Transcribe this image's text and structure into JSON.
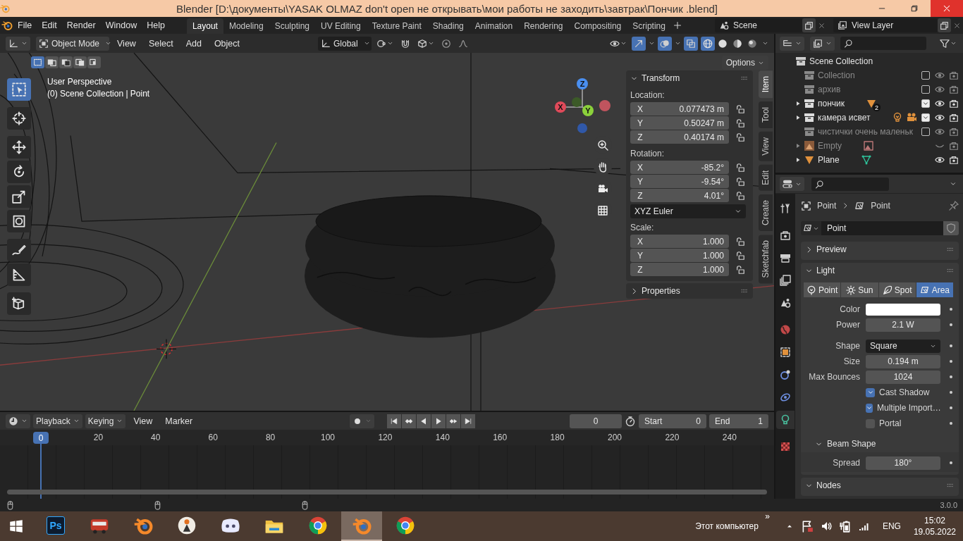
{
  "window": {
    "title": "Blender [D:\\документы\\YASAK OLMAZ don't open не открывать\\мои работы не заходить\\завтрак\\Пончик  .blend]"
  },
  "menu": [
    "File",
    "Edit",
    "Render",
    "Window",
    "Help"
  ],
  "workspaces": [
    {
      "label": "Layout",
      "selected": true
    },
    {
      "label": "Modeling",
      "selected": false
    },
    {
      "label": "Sculpting",
      "selected": false
    },
    {
      "label": "UV Editing",
      "selected": false
    },
    {
      "label": "Texture Paint",
      "selected": false
    },
    {
      "label": "Shading",
      "selected": false
    },
    {
      "label": "Animation",
      "selected": false
    },
    {
      "label": "Rendering",
      "selected": false
    },
    {
      "label": "Compositing",
      "selected": false
    },
    {
      "label": "Scripting",
      "selected": false
    }
  ],
  "scene": "Scene",
  "view_layer": "View Layer",
  "viewport": {
    "mode": "Object Mode",
    "menus": [
      "View",
      "Select",
      "Add",
      "Object"
    ],
    "orientation": "Global",
    "xray": true,
    "overlays": true,
    "gizmos": true,
    "shading": [
      {
        "kind": "wireframe",
        "selected": true
      },
      {
        "kind": "solid",
        "selected": false
      },
      {
        "kind": "material",
        "selected": false
      },
      {
        "kind": "rendered",
        "selected": false
      }
    ],
    "select_modes": [
      {
        "kind": "new",
        "selected": true
      },
      {
        "kind": "extend",
        "selected": false
      },
      {
        "kind": "subtract",
        "selected": false
      },
      {
        "kind": "invert",
        "selected": false
      },
      {
        "kind": "intersect",
        "selected": false
      }
    ],
    "options": "Options",
    "overlay_lines": [
      "User Perspective",
      "(0) Scene Collection | Point"
    ],
    "tools": [
      {
        "kind": "select",
        "selected": true
      },
      {
        "kind": "cursor",
        "selected": false
      },
      {
        "kind": "move",
        "selected": false
      },
      {
        "kind": "rotate",
        "selected": false
      },
      {
        "kind": "scale",
        "selected": false
      },
      {
        "kind": "transform",
        "selected": false
      },
      {
        "kind": "annotate",
        "selected": false
      },
      {
        "kind": "measure",
        "selected": false
      },
      {
        "kind": "add",
        "selected": false
      }
    ],
    "gizmo": [
      "X",
      "Y",
      "Z"
    ],
    "sidebar": {
      "tabs": [
        {
          "label": "Item",
          "selected": true
        },
        {
          "label": "Tool",
          "selected": false
        },
        {
          "label": "View",
          "selected": false
        },
        {
          "label": "Edit",
          "selected": false
        },
        {
          "label": "Create",
          "selected": false
        },
        {
          "label": "Sketchfab",
          "selected": false
        }
      ],
      "transform": {
        "title": "Transform",
        "expanded": true,
        "groups": [
          {
            "label": "Location:",
            "rows": [
              {
                "axis": "X",
                "value": "0.077473 m"
              },
              {
                "axis": "Y",
                "value": "0.50247 m"
              },
              {
                "axis": "Z",
                "value": "0.40174 m"
              }
            ]
          },
          {
            "label": "Rotation:",
            "rows": [
              {
                "axis": "X",
                "value": "-85.2°"
              },
              {
                "axis": "Y",
                "value": "-9.54°"
              },
              {
                "axis": "Z",
                "value": "4.01°"
              }
            ],
            "mode": "XYZ Euler"
          },
          {
            "label": "Scale:",
            "rows": [
              {
                "axis": "X",
                "value": "1.000"
              },
              {
                "axis": "Y",
                "value": "1.000"
              },
              {
                "axis": "Z",
                "value": "1.000"
              }
            ]
          }
        ]
      },
      "properties": {
        "title": "Properties",
        "expanded": false
      }
    }
  },
  "timeline": {
    "menus": [
      {
        "label": "Playback",
        "kind": "dropdown"
      },
      {
        "label": "Keying",
        "kind": "dropdown"
      },
      {
        "label": "View",
        "kind": "plain"
      },
      {
        "label": "Marker",
        "kind": "plain"
      }
    ],
    "frame": "0",
    "start": {
      "label": "Start",
      "value": "0"
    },
    "end": {
      "label": "End",
      "value": "1"
    },
    "playhead": "0",
    "ticks": [
      "20",
      "40",
      "60",
      "80",
      "100",
      "120",
      "140",
      "160",
      "180",
      "200",
      "220",
      "240"
    ]
  },
  "outliner": {
    "root": "Scene Collection",
    "items": [
      {
        "name": "Collection",
        "kind": "collection",
        "expandable": false,
        "dimmed": true,
        "checked": false,
        "visible": true
      },
      {
        "name": "архив",
        "kind": "collection",
        "expandable": false,
        "dimmed": true,
        "checked": false,
        "visible": true
      },
      {
        "name": "пончик",
        "kind": "collection",
        "expandable": true,
        "dimmed": false,
        "checked": true,
        "visible": true,
        "contents": [
          {
            "kind": "mesh",
            "count": "2"
          }
        ]
      },
      {
        "name": "камера исвет",
        "kind": "collection",
        "expandable": true,
        "dimmed": false,
        "checked": true,
        "visible": true,
        "contents": [
          {
            "kind": "light"
          },
          {
            "kind": "camera"
          }
        ]
      },
      {
        "name": "чистички очень маленьк",
        "kind": "collection",
        "expandable": false,
        "dimmed": true,
        "checked": false,
        "visible": true
      },
      {
        "name": "Empty",
        "kind": "empty",
        "expandable": true,
        "dimmed": true,
        "visible": false,
        "contents": [
          {
            "kind": "image"
          }
        ]
      },
      {
        "name": "Plane",
        "kind": "mesh",
        "expandable": true,
        "dimmed": false,
        "visible": true,
        "contents": [
          {
            "kind": "vertices"
          }
        ]
      }
    ]
  },
  "properties": {
    "tabs": [
      {
        "kind": "tool",
        "selected": false
      },
      {
        "kind": "render",
        "selected": false
      },
      {
        "kind": "output",
        "selected": false
      },
      {
        "kind": "view-layer",
        "selected": false
      },
      {
        "kind": "scene",
        "selected": false
      },
      {
        "kind": "world",
        "selected": false
      },
      {
        "kind": "object",
        "selected": false
      },
      {
        "kind": "physics",
        "selected": false
      },
      {
        "kind": "constraints",
        "selected": false
      },
      {
        "kind": "light-data",
        "selected": true
      },
      {
        "kind": "texture",
        "selected": false
      }
    ],
    "breadcrumb": [
      "Point",
      "Point"
    ],
    "datablock": "Point",
    "panels": [
      {
        "title": "Preview",
        "expanded": false
      },
      {
        "title": "Light",
        "expanded": true,
        "types": [
          {
            "kind": "point",
            "label": "Point",
            "selected": false
          },
          {
            "kind": "sun",
            "label": "Sun",
            "selected": false
          },
          {
            "kind": "spot",
            "label": "Spot",
            "selected": false
          },
          {
            "kind": "area",
            "label": "Area",
            "selected": true
          }
        ],
        "rows": [
          {
            "kind": "color",
            "label": "Color",
            "color": "#ffffff"
          },
          {
            "kind": "number",
            "label": "Power",
            "value": "2.1 W"
          },
          {
            "kind": "select",
            "label": "Shape",
            "value": "Square"
          },
          {
            "kind": "number",
            "label": "Size",
            "value": "0.194 m"
          },
          {
            "kind": "number",
            "label": "Max Bounces",
            "value": "1024"
          },
          {
            "kind": "check",
            "label": "Cast Shadow",
            "checked": true
          },
          {
            "kind": "check",
            "label": "Multiple Import…",
            "checked": true
          },
          {
            "kind": "check",
            "label": "Portal",
            "checked": false
          }
        ],
        "subpanels": [
          {
            "title": "Beam Shape",
            "expanded": true,
            "rows": [
              {
                "kind": "number",
                "label": "Spread",
                "value": "180°"
              }
            ]
          }
        ]
      },
      {
        "title": "Nodes",
        "expanded": true
      }
    ]
  },
  "status": {
    "version": "3.0.0"
  },
  "taskbar": {
    "apps": [
      {
        "kind": "photoshop",
        "label": "Ps",
        "selected": false
      },
      {
        "kind": "bus",
        "selected": false
      },
      {
        "kind": "blender",
        "selected": false
      },
      {
        "kind": "figure",
        "selected": false
      },
      {
        "kind": "discord",
        "selected": false
      },
      {
        "kind": "folder",
        "selected": false
      },
      {
        "kind": "chrome",
        "selected": false
      },
      {
        "kind": "blender",
        "selected": true
      },
      {
        "kind": "chrome",
        "selected": false
      }
    ],
    "toolbar_label": "Этот компьютер",
    "toolbar_more": "»",
    "language": "ENG",
    "time": "15:02",
    "date": "19.05.2022"
  }
}
